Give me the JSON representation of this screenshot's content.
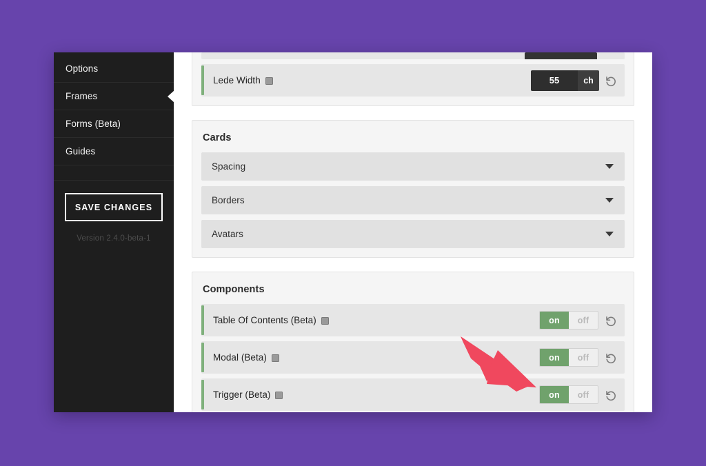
{
  "window": {
    "sidebar": {
      "nav_items": [
        {
          "label": "Options",
          "active": false
        },
        {
          "label": "Frames",
          "active": true
        },
        {
          "label": "Forms (Beta)",
          "active": false
        },
        {
          "label": "Guides",
          "active": false
        }
      ],
      "save_button": "SAVE CHANGES",
      "version": "Version 2.4.0-beta-1"
    },
    "content": {
      "clipped_panel": {
        "visible_row_hint": ""
      },
      "lede_row": {
        "label": "Lede Width",
        "value": "55",
        "unit": "ch",
        "info_icon": "info-icon",
        "reset_icon": "reset-icon"
      },
      "cards_panel": {
        "title": "Cards",
        "accordions": [
          {
            "label": "Spacing",
            "icon": "chevron-down-icon"
          },
          {
            "label": "Borders",
            "icon": "chevron-down-icon"
          },
          {
            "label": "Avatars",
            "icon": "chevron-down-icon"
          }
        ]
      },
      "components_panel": {
        "title": "Components",
        "toggle_on_label": "on",
        "toggle_off_label": "off",
        "rows": [
          {
            "label": "Table Of Contents (Beta)",
            "state": "on"
          },
          {
            "label": "Modal (Beta)",
            "state": "on"
          },
          {
            "label": "Trigger (Beta)",
            "state": "on"
          }
        ]
      }
    }
  },
  "colors": {
    "desktop_background": "#6744ac",
    "sidebar_background": "#1e1e1e",
    "accent_green": "#70a26c",
    "annotation_red": "#f0485e",
    "panel_background": "#f5f5f5",
    "row_background": "#e6e6e6"
  }
}
